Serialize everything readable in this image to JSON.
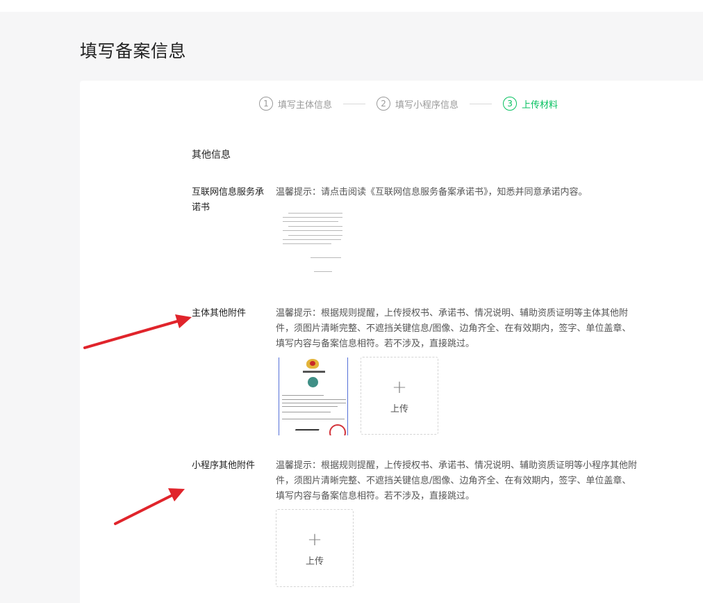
{
  "page": {
    "title": "填写备案信息"
  },
  "steps": [
    {
      "num": "1",
      "label": "填写主体信息",
      "state": "done"
    },
    {
      "num": "2",
      "label": "填写小程序信息",
      "state": "done"
    },
    {
      "num": "3",
      "label": "上传材料",
      "state": "active"
    }
  ],
  "section": {
    "title": "其他信息"
  },
  "commitment": {
    "label": "互联网信息服务承诺书",
    "tip_prefix": "温馨提示：请点击阅读",
    "tip_link": "《互联网信息服务备案承诺书》",
    "tip_suffix": "，知悉并同意承诺内容。"
  },
  "subject_attachments": {
    "label": "主体其他附件",
    "tip": "温馨提示：根据规则提醒，上传授权书、承诺书、情况说明、辅助资质证明等主体其他附件，须图片清晰完整、不遮挡关键信息/图像、边角齐全、在有效期内，签字、单位盖章、填写内容与备案信息相符。若不涉及，直接跳过。",
    "upload_plus": "+",
    "upload_label": "上传"
  },
  "miniprogram_attachments": {
    "label": "小程序其他附件",
    "tip": "温馨提示：根据规则提醒，上传授权书、承诺书、情况说明、辅助资质证明等小程序其他附件，须图片清晰完整、不遮挡关键信息/图像、边角齐全、在有效期内，签字、单位盖章、填写内容与备案信息相符。若不涉及，直接跳过。",
    "upload_plus": "+",
    "upload_label": "上传"
  },
  "colors": {
    "accent": "#07c160",
    "annotation_arrow": "#e0242b"
  }
}
